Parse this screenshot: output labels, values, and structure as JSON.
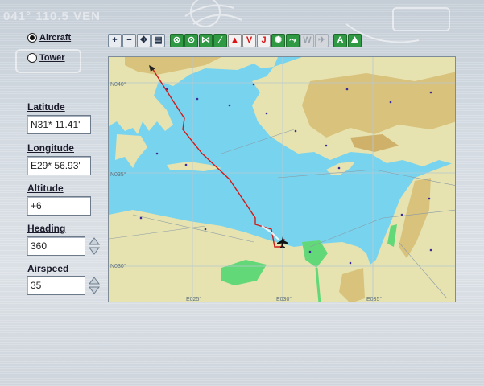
{
  "background_text": "041° 110.5 VEN",
  "mode": {
    "aircraft_label": "Aircraft",
    "tower_label": "Tower",
    "selected": "aircraft"
  },
  "fields": {
    "latitude_label": "Latitude",
    "latitude_value": "N31* 11.41'",
    "longitude_label": "Longitude",
    "longitude_value": "E29* 56.93'",
    "altitude_label": "Altitude",
    "altitude_value": "+6",
    "heading_label": "Heading",
    "heading_value": "360",
    "airspeed_label": "Airspeed",
    "airspeed_value": "35"
  },
  "toolbar": [
    {
      "name": "zoom-in-button",
      "icon": "zoom-in-icon",
      "glyph": "+"
    },
    {
      "name": "zoom-out-button",
      "icon": "zoom-out-icon",
      "glyph": "−"
    },
    {
      "name": "center-button",
      "icon": "crosshair-icon",
      "glyph": "✥"
    },
    {
      "name": "print-button",
      "icon": "printer-icon",
      "glyph": "▤"
    },
    {
      "name": "vor-button",
      "icon": "vor-icon",
      "glyph": "⊗"
    },
    {
      "name": "ndb-button",
      "icon": "ndb-icon",
      "glyph": "⊙"
    },
    {
      "name": "ils-button",
      "icon": "ils-icon",
      "glyph": "⋈"
    },
    {
      "name": "route-button",
      "icon": "route-icon",
      "glyph": "∕"
    },
    {
      "name": "waypoint-button",
      "icon": "waypoint-icon",
      "glyph": "▲"
    },
    {
      "name": "victor-airways-button",
      "icon": "victor-airway-icon",
      "glyph": "V"
    },
    {
      "name": "jet-airways-button",
      "icon": "jet-airway-icon",
      "glyph": "J"
    },
    {
      "name": "airport-button",
      "icon": "airport-icon",
      "glyph": "✺"
    },
    {
      "name": "flight-path-button",
      "icon": "flight-path-icon",
      "glyph": "⤳"
    },
    {
      "name": "weather-button",
      "icon": "weather-icon",
      "glyph": "W"
    },
    {
      "name": "traffic-button",
      "icon": "traffic-icon",
      "glyph": "✈"
    },
    {
      "name": "labels-button",
      "icon": "labels-icon",
      "glyph": "A"
    },
    {
      "name": "terrain-button",
      "icon": "terrain-icon",
      "glyph": "⛰"
    }
  ],
  "map": {
    "grid_labels": {
      "lat_top": "N040°",
      "lat_mid": "N035°",
      "lat_bottom": "N030°",
      "lon_left": "E025°",
      "lon_mid": "E030°",
      "lon_right": "E035°"
    },
    "colors": {
      "sea": "#78d4ee",
      "land": "#e6e3b0",
      "highland": "#d9c27c",
      "green": "#62d878",
      "route": "#d11a1a"
    }
  }
}
